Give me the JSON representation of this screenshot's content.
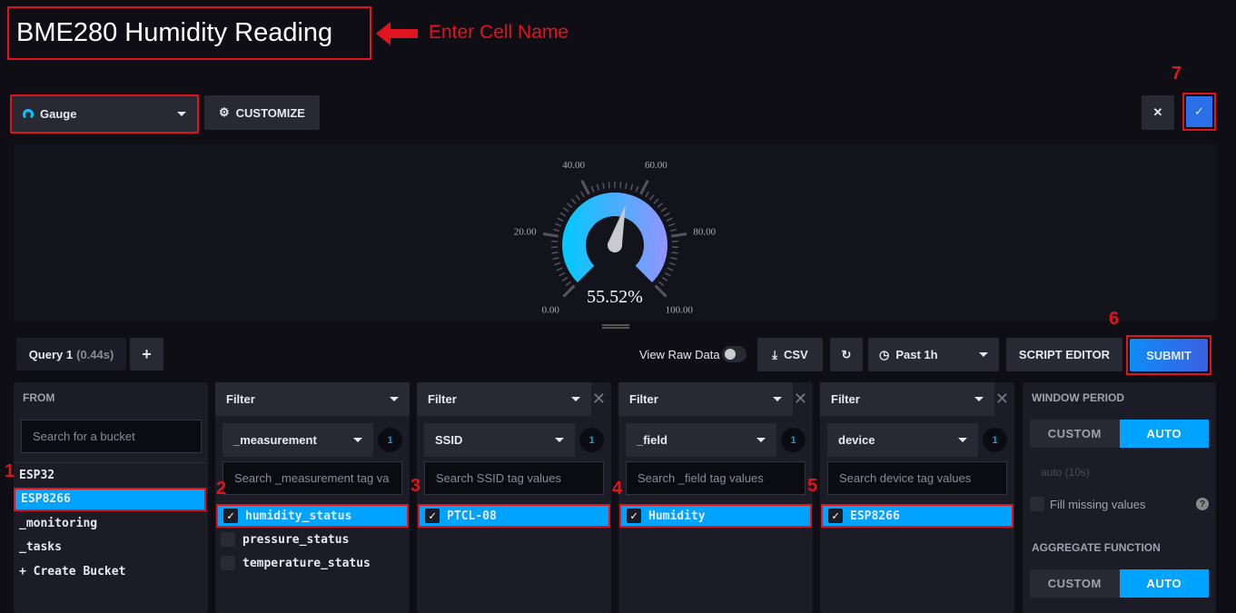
{
  "cell": {
    "title": "BME280 Humidity Reading"
  },
  "annotations": {
    "enter_cell_name": "Enter Cell Name",
    "n1": "1",
    "n2": "2",
    "n3": "3",
    "n4": "4",
    "n5": "5",
    "n6": "6",
    "n7": "7"
  },
  "toolbar": {
    "viz_type": "Gauge",
    "customize": "CUSTOMIZE",
    "cancel_icon": "close-icon",
    "confirm_icon": "check-icon"
  },
  "gauge": {
    "value": 55.52,
    "min": 0,
    "max": 100,
    "display": "55.52%",
    "ticks": [
      "0.00",
      "20.00",
      "40.00",
      "60.00",
      "80.00",
      "100.00"
    ],
    "colors": [
      "#00c9ff",
      "#9394ff"
    ]
  },
  "query": {
    "tab": "Query 1",
    "time": "(0.44s)",
    "add": "+",
    "view_raw": "View Raw Data",
    "csv": "CSV",
    "range": "Past 1h",
    "script_editor": "SCRIPT EDITOR",
    "submit": "SUBMIT"
  },
  "from": {
    "label": "FROM",
    "placeholder": "Search for a bucket",
    "buckets": [
      "ESP32",
      "ESP8266",
      "_monitoring",
      "_tasks",
      "+ Create Bucket"
    ],
    "selected": "ESP8266"
  },
  "filters": [
    {
      "label": "Filter",
      "key": "_measurement",
      "count": "1",
      "placeholder": "Search _measurement tag va",
      "values": [
        {
          "v": "humidity_status",
          "on": true
        },
        {
          "v": "pressure_status",
          "on": false
        },
        {
          "v": "temperature_status",
          "on": false
        }
      ]
    },
    {
      "label": "Filter",
      "key": "SSID",
      "count": "1",
      "placeholder": "Search SSID tag values",
      "values": [
        {
          "v": "PTCL-08",
          "on": true
        }
      ]
    },
    {
      "label": "Filter",
      "key": "_field",
      "count": "1",
      "placeholder": "Search _field tag values",
      "values": [
        {
          "v": "Humidity",
          "on": true
        }
      ]
    },
    {
      "label": "Filter",
      "key": "device",
      "count": "1",
      "placeholder": "Search device tag values",
      "values": [
        {
          "v": "ESP8266",
          "on": true
        }
      ]
    }
  ],
  "window": {
    "title": "WINDOW PERIOD",
    "custom": "CUSTOM",
    "auto": "AUTO",
    "auto_value": "auto (10s)",
    "fill_missing": "Fill missing values",
    "agg_title": "AGGREGATE FUNCTION",
    "agg_custom": "CUSTOM",
    "agg_auto": "AUTO"
  },
  "colors": {
    "accent": "#00a3ff",
    "annotation": "#e0141e"
  }
}
